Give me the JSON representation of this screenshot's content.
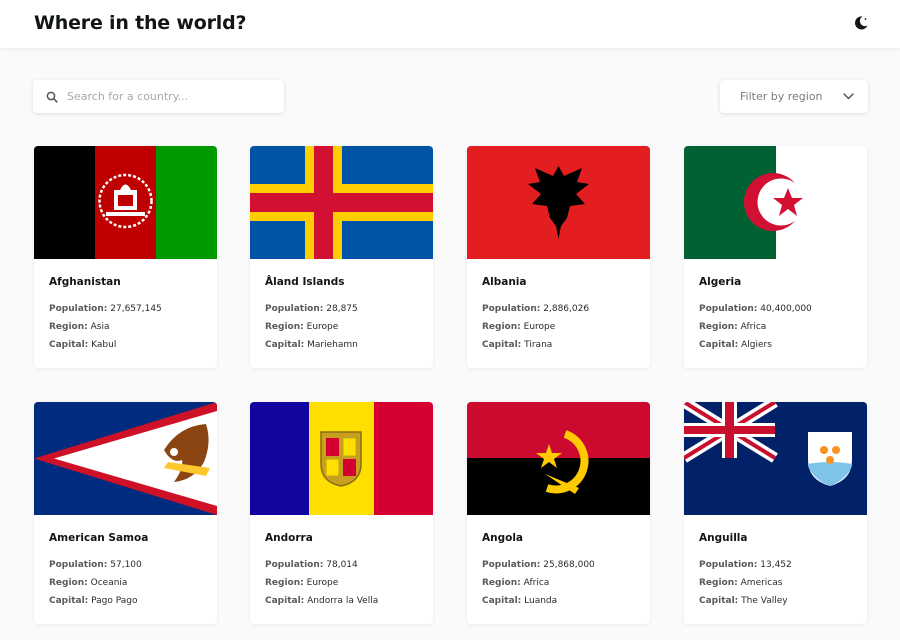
{
  "header": {
    "title": "Where in the world?",
    "theme_icon": "moon-icon"
  },
  "search": {
    "placeholder": "Search for a country...",
    "value": ""
  },
  "filter": {
    "label": "Filter by region"
  },
  "labels": {
    "population": "Population:",
    "region": "Region:",
    "capital": "Capital:"
  },
  "countries": [
    {
      "name": "Afghanistan",
      "population": "27,657,145",
      "region": "Asia",
      "capital": "Kabul"
    },
    {
      "name": "Åland Islands",
      "population": "28,875",
      "region": "Europe",
      "capital": "Mariehamn"
    },
    {
      "name": "Albania",
      "population": "2,886,026",
      "region": "Europe",
      "capital": "Tirana"
    },
    {
      "name": "Algeria",
      "population": "40,400,000",
      "region": "Africa",
      "capital": "Algiers"
    },
    {
      "name": "American Samoa",
      "population": "57,100",
      "region": "Oceania",
      "capital": "Pago Pago"
    },
    {
      "name": "Andorra",
      "population": "78,014",
      "region": "Europe",
      "capital": "Andorra la Vella"
    },
    {
      "name": "Angola",
      "population": "25,868,000",
      "region": "Africa",
      "capital": "Luanda"
    },
    {
      "name": "Anguilla",
      "population": "13,452",
      "region": "Americas",
      "capital": "The Valley"
    }
  ]
}
